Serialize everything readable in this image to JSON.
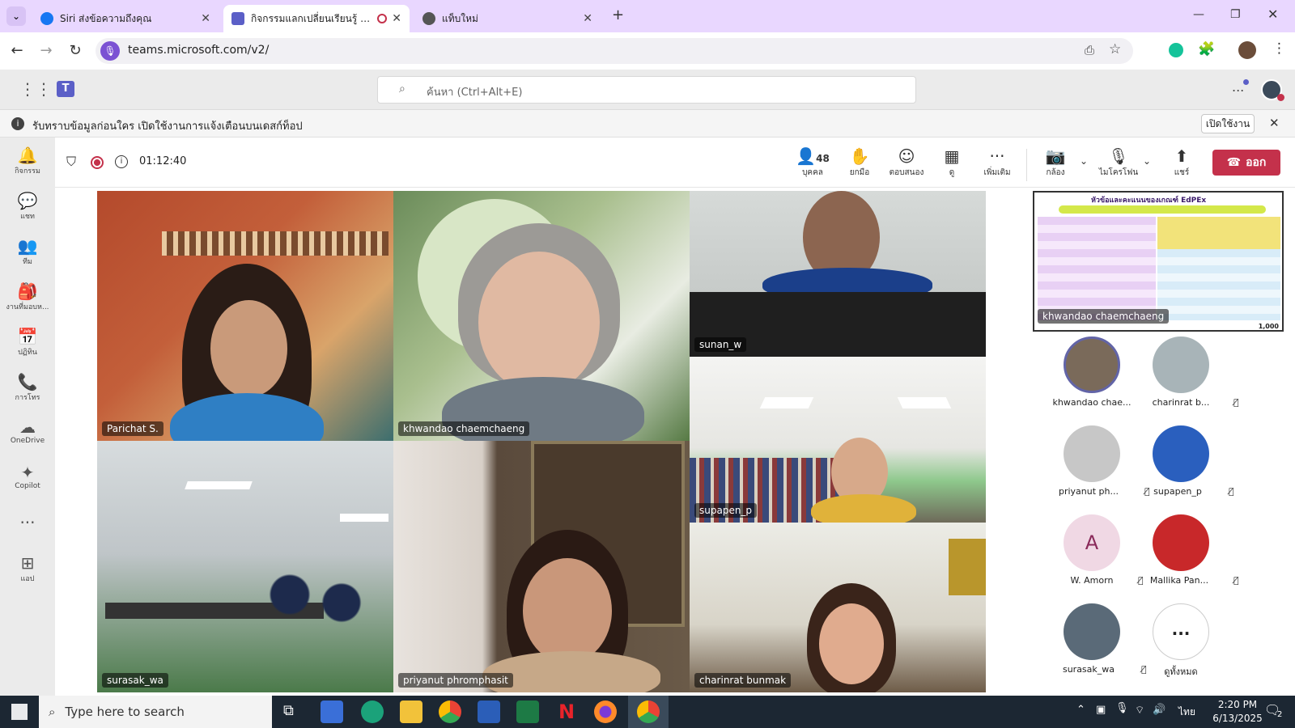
{
  "browser": {
    "tabs": [
      {
        "title": "Siri ส่งข้อความถึงคุณ",
        "active": false
      },
      {
        "title": "กิจกรรมแลกเปลี่ยนเรียนรู้ SAR",
        "active": true
      },
      {
        "title": "แท็บใหม่",
        "active": false
      }
    ],
    "url": "teams.microsoft.com/v2/",
    "new_tab": "+"
  },
  "teams": {
    "search_placeholder": "ค้นหา (Ctrl+Alt+E)",
    "more": "...",
    "banner_text": "รับทราบข้อมูลก่อนใคร เปิดใช้งานการแจ้งเตือนบนเดสก์ท็อป",
    "banner_button": "เปิดใช้งาน"
  },
  "rail": [
    {
      "label": "กิจกรรม",
      "icon": "bell-icon",
      "glyph": "🔔"
    },
    {
      "label": "แชท",
      "icon": "chat-icon",
      "glyph": "💬"
    },
    {
      "label": "ทีม",
      "icon": "teams-icon",
      "glyph": "👥"
    },
    {
      "label": "งานที่มอบห...",
      "icon": "assignment-icon",
      "glyph": "🎒"
    },
    {
      "label": "ปฏิทิน",
      "icon": "calendar-icon",
      "glyph": "📅"
    },
    {
      "label": "การโทร",
      "icon": "phone-icon",
      "glyph": "📞"
    },
    {
      "label": "OneDrive",
      "icon": "cloud-icon",
      "glyph": "☁"
    },
    {
      "label": "Copilot",
      "icon": "copilot-icon",
      "glyph": "✦"
    },
    {
      "label": "",
      "icon": "more-icon",
      "glyph": "···"
    },
    {
      "label": "แอป",
      "icon": "apps-icon",
      "glyph": "⊞"
    }
  ],
  "meeting": {
    "timer": "01:12:40",
    "participant_count": "48",
    "buttons": {
      "people": "บุคคล",
      "raise_hand": "ยกมือ",
      "react": "ตอบสนอง",
      "view": "ดู",
      "more": "เพิ่มเติม",
      "camera": "กล้อง",
      "mic": "ไมโครโฟน",
      "share": "แชร์",
      "leave": "ออก"
    }
  },
  "tiles": [
    {
      "name": "Parichat S."
    },
    {
      "name": "khwandao chaemchaeng"
    },
    {
      "name": "sunan_w"
    },
    {
      "name": "supapen_p"
    },
    {
      "name": "surasak_wa"
    },
    {
      "name": "priyanut phromphasit"
    },
    {
      "name": "charinrat bunmak"
    }
  ],
  "shared_screen": {
    "title": "หัวข้อและคะแนนของเกณฑ์ EdPEx",
    "presenter": "khwandao chaemchaeng",
    "footer_value": "1,000"
  },
  "gallery": [
    {
      "name": "khwandao chae...",
      "muted": false,
      "initial": ""
    },
    {
      "name": "charinrat b...",
      "muted": true,
      "initial": ""
    },
    {
      "name": "priyanut ph...",
      "muted": true,
      "initial": ""
    },
    {
      "name": "supapen_p",
      "muted": true,
      "initial": ""
    },
    {
      "name": "W. Amorn",
      "muted": true,
      "initial": "A"
    },
    {
      "name": "Mallika Pan...",
      "muted": true,
      "initial": ""
    },
    {
      "name": "surasak_wa",
      "muted": true,
      "initial": ""
    },
    {
      "name": "ดูทั้งหมด",
      "muted": false,
      "initial": "..."
    }
  ],
  "taskbar": {
    "search_placeholder": "Type here to search",
    "language": "ไทย",
    "time": "2:20 PM",
    "date": "6/13/2025",
    "notifications": "2"
  }
}
